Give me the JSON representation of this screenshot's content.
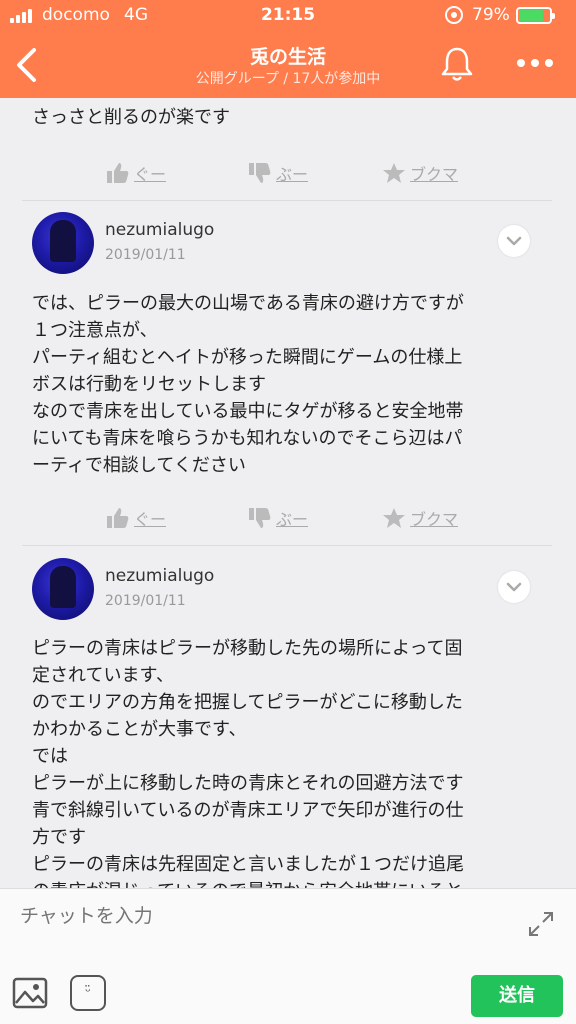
{
  "status_bar": {
    "carrier": "docomo",
    "network": "4G",
    "time": "21:15",
    "battery_percent": "79%",
    "battery_level": 0.79
  },
  "header": {
    "title": "兎の生活",
    "subtitle": "公開グループ / 17人が参加中",
    "back_icon": "chevron-left-icon",
    "bell_icon": "bell-icon",
    "more_icon": "more-dots-icon"
  },
  "first_post_tail": "さっさと削るのが楽です",
  "actions": {
    "like": "ぐー",
    "dislike": "ぶー",
    "bookmark": "ブクマ"
  },
  "posts": [
    {
      "username": "nezumialugo",
      "date": "2019/01/11",
      "lines": [
        "では、ピラーの最大の山場である青床の避け方ですが",
        "１つ注意点が、",
        "パーティ組むとヘイトが移った瞬間にゲームの仕様上",
        "ボスは行動をリセットします",
        "なので青床を出している最中にタゲが移ると安全地帯",
        "にいても青床を喰らうかも知れないのでそこら辺はパ",
        "ーティで相談してください"
      ]
    },
    {
      "username": "nezumialugo",
      "date": "2019/01/11",
      "lines": [
        "ピラーの青床はピラーが移動した先の場所によって固",
        "定されています、",
        "のでエリアの方角を把握してピラーがどこに移動した",
        "かわかることが大事です、",
        "では",
        "ピラーが上に移動した時の青床とそれの回避方法です",
        "青で斜線引いているのが青床エリアで矢印が進行の仕",
        "方です",
        "ピラーの青床は先程固定と言いましたが１つだけ追尾",
        "の青床が混じっているので最初から安全地帯にいると"
      ]
    }
  ],
  "input": {
    "placeholder": "チャットを入力",
    "send_label": "送信"
  },
  "colors": {
    "accent": "#ff7c4d",
    "send": "#22c35a"
  }
}
